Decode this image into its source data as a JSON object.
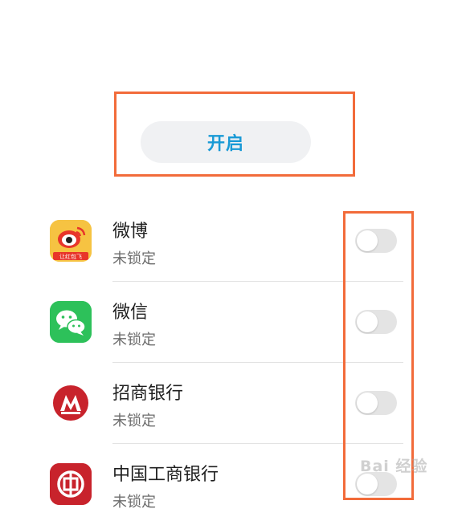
{
  "enable": {
    "label": "开启"
  },
  "apps": [
    {
      "name": "微博",
      "status": "未锁定",
      "icon": "weibo-icon",
      "locked": false
    },
    {
      "name": "微信",
      "status": "未锁定",
      "icon": "wechat-icon",
      "locked": false
    },
    {
      "name": "招商银行",
      "status": "未锁定",
      "icon": "cmb-icon",
      "locked": false
    },
    {
      "name": "中国工商银行",
      "status": "未锁定",
      "icon": "icbc-icon",
      "locked": false
    }
  ],
  "weibo_badge": "让红包飞",
  "watermark": {
    "text": "Bai 经验"
  },
  "colors": {
    "accent": "#1a9ad6",
    "highlight": "#f26b3a",
    "toggle_off": "#e4e4e4"
  }
}
